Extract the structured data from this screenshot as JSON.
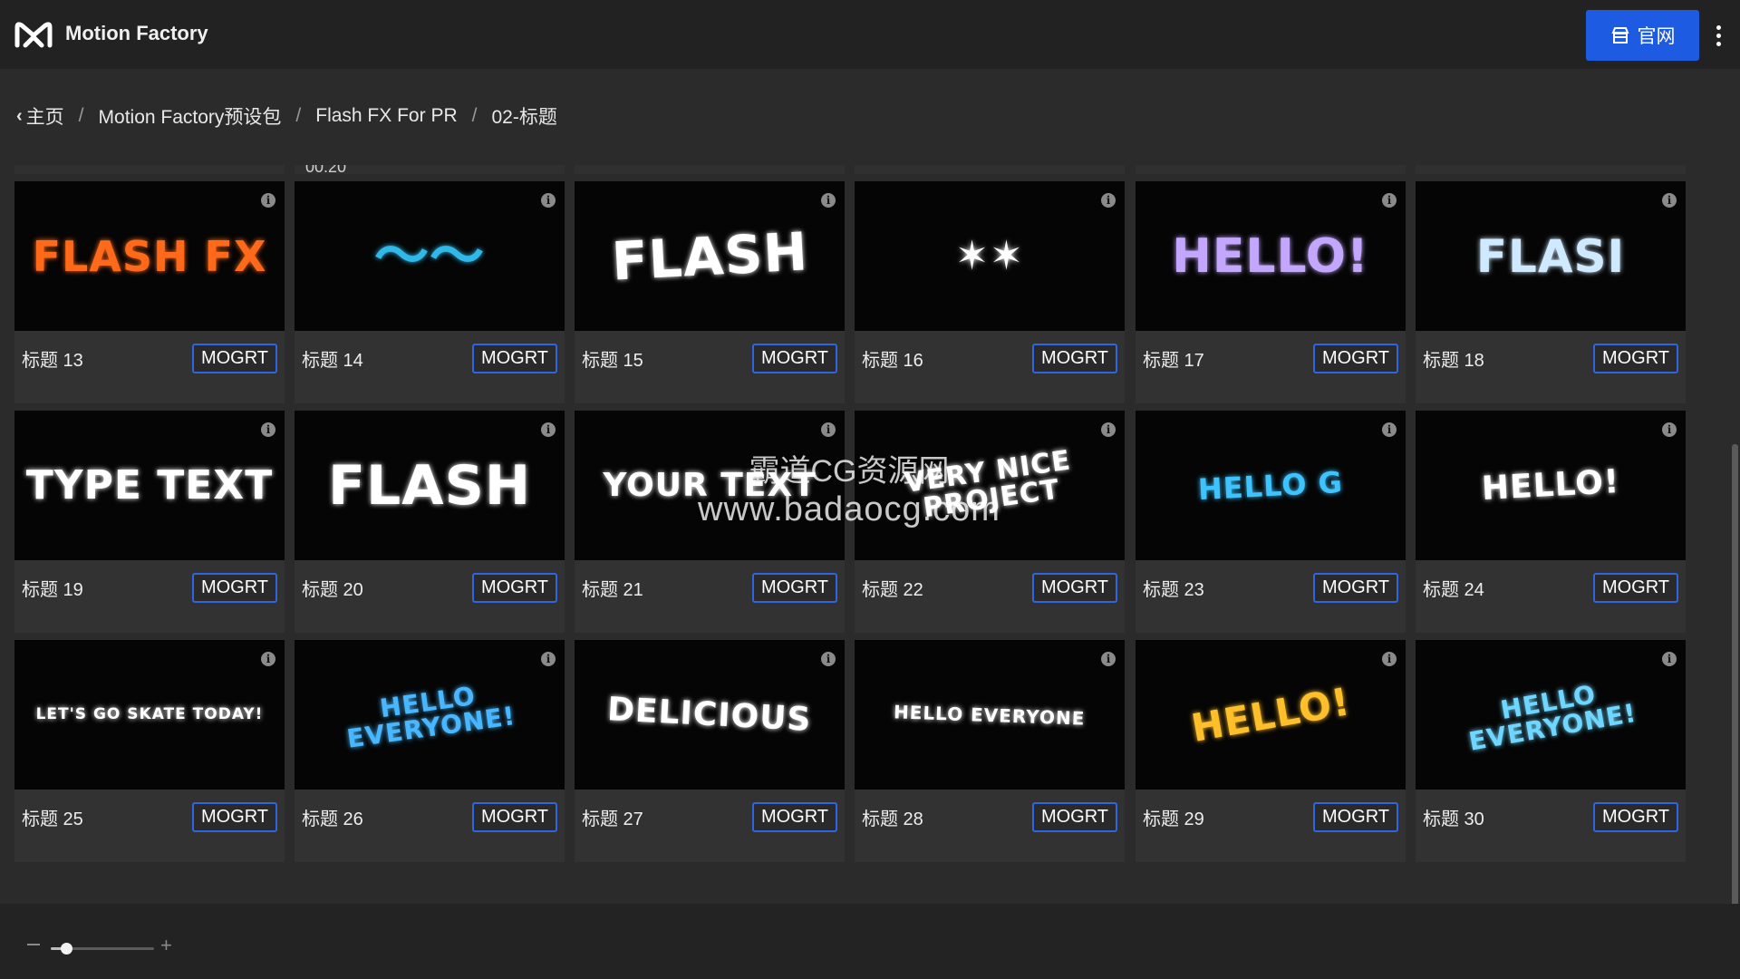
{
  "header": {
    "app_title": "Motion Factory",
    "site_button_label": "官网"
  },
  "breadcrumb": {
    "items": [
      "主页",
      "Motion Factory预设包",
      "Flash FX For PR",
      "02-标题"
    ]
  },
  "previous_row": {
    "time_label": "00:20"
  },
  "cards": [
    {
      "label": "标题 13",
      "button": "MOGRT",
      "art": "FLASH FX",
      "art_color": "#ff6a1a"
    },
    {
      "label": "标题 14",
      "button": "MOGRT",
      "art": "〜〜",
      "art_color": "#2fb8e8"
    },
    {
      "label": "标题 15",
      "button": "MOGRT",
      "art": "FLASH",
      "art_color": "#ffffff"
    },
    {
      "label": "标题 16",
      "button": "MOGRT",
      "art": "✶✶",
      "art_color": "#ffffff"
    },
    {
      "label": "标题 17",
      "button": "MOGRT",
      "art": "HELLO!",
      "art_color": "#c3a7ff"
    },
    {
      "label": "标题 18",
      "button": "MOGRT",
      "art": "FLASI",
      "art_color": "#cfe9ff"
    },
    {
      "label": "标题 19",
      "button": "MOGRT",
      "art": "TYPE TEXT",
      "art_color": "#ffffff"
    },
    {
      "label": "标题 20",
      "button": "MOGRT",
      "art": "FLASH",
      "art_color": "#ffffff"
    },
    {
      "label": "标题 21",
      "button": "MOGRT",
      "art": "YOUR TEXT",
      "art_color": "#ffffff"
    },
    {
      "label": "标题 22",
      "button": "MOGRT",
      "art": "VERY NICE PROJECT",
      "art_color": "#ffffff"
    },
    {
      "label": "标题 23",
      "button": "MOGRT",
      "art": "HELLO G",
      "art_color": "#3ec3ff"
    },
    {
      "label": "标题 24",
      "button": "MOGRT",
      "art": "HELLO!",
      "art_color": "#ffffff"
    },
    {
      "label": "标题 25",
      "button": "MOGRT",
      "art": "LET'S GO SKATE TODAY!",
      "art_color": "#ffffff"
    },
    {
      "label": "标题 26",
      "button": "MOGRT",
      "art": "HELLO EVERYONE!",
      "art_color": "#49b7ff"
    },
    {
      "label": "标题 27",
      "button": "MOGRT",
      "art": "DELICIOUS",
      "art_color": "#ffffff"
    },
    {
      "label": "标题 28",
      "button": "MOGRT",
      "art": "HELLO EVERYONE",
      "art_color": "#ffffff"
    },
    {
      "label": "标题 29",
      "button": "MOGRT",
      "art": "HELLO!",
      "art_color": "#ffbf2a"
    },
    {
      "label": "标题 30",
      "button": "MOGRT",
      "art": "HELLO EVERYONE!",
      "art_color": "#6fd6ff"
    }
  ],
  "watermark": {
    "line1": "霸道CG资源网",
    "line2": "www.badaocg.com"
  },
  "zoom": {
    "level": 0.15
  },
  "colors": {
    "accent": "#1e5be3",
    "mogrt_border": "#2f66e0"
  }
}
